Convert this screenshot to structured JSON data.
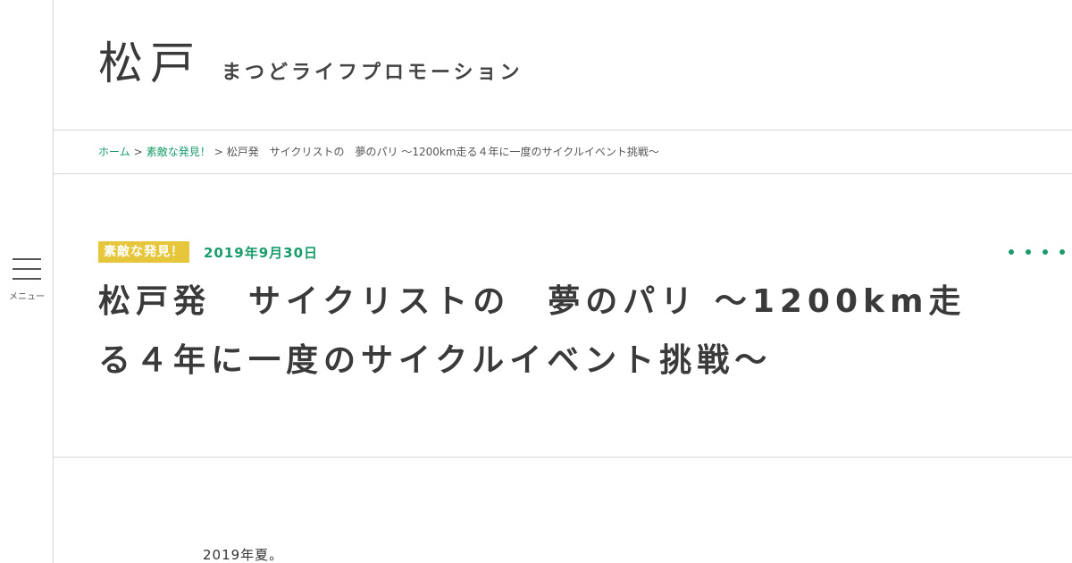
{
  "site": {
    "logo_mark": "松戸",
    "tagline": "まつどライフプロモーション"
  },
  "menu": {
    "label": "メニュー"
  },
  "breadcrumb": {
    "home": "ホーム",
    "separator": ">",
    "category": "素敵な発見！",
    "current": "松戸発　サイクリストの　夢のパリ ～1200km走る４年に一度のサイクルイベント挑戦～"
  },
  "article": {
    "category": "素敵な発見！",
    "date": "2019年9月30日",
    "title": "松戸発　サイクリストの　夢のパリ ～1200km走る４年に一度のサイクルイベント挑戦～",
    "first_paragraph": "2019年夏。"
  },
  "colors": {
    "accent_green": "#1a9c6a",
    "badge_yellow": "#e6c63a",
    "text_dark": "#3a3a3a"
  },
  "icons": {
    "menu": "hamburger-icon",
    "more": "dots-icon"
  }
}
